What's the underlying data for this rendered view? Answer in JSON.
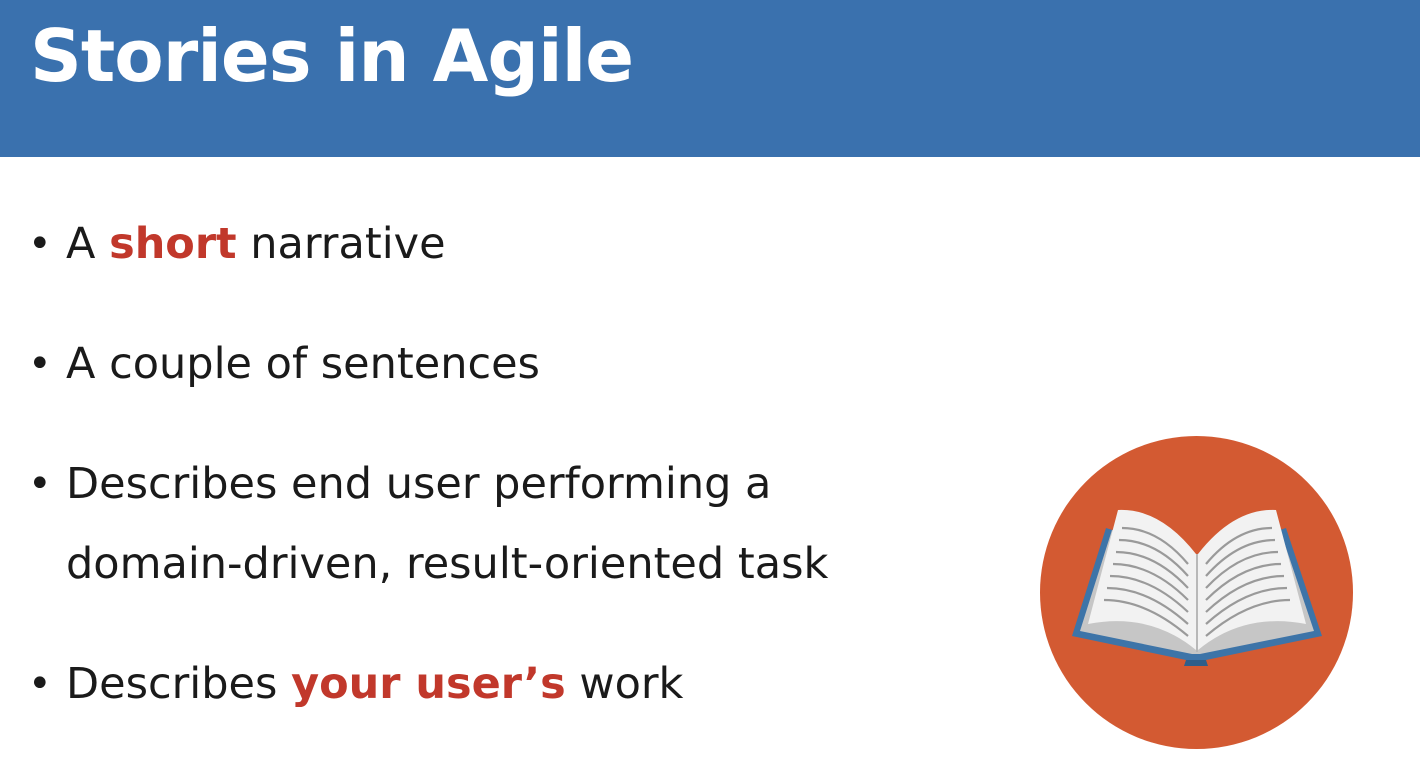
{
  "slide": {
    "title": "Stories in Agile",
    "bullets": [
      {
        "before": "A ",
        "emphasis": "short",
        "after": " narrative"
      },
      {
        "text": "A couple of sentences"
      },
      {
        "line1": "Describes end user performing a",
        "line2": "domain-driven, result-oriented task"
      },
      {
        "before": "Describes ",
        "emphasis": "your user’s",
        "after": " work"
      }
    ],
    "bullet_glyph": "•"
  },
  "icon": {
    "name": "open-book-icon",
    "circle_color": "#d35a32",
    "cover_color": "#3d74a8",
    "page_color": "#f2f2f2"
  },
  "colors": {
    "title_bar": "#3a71ae",
    "emphasis": "#c1382b"
  }
}
